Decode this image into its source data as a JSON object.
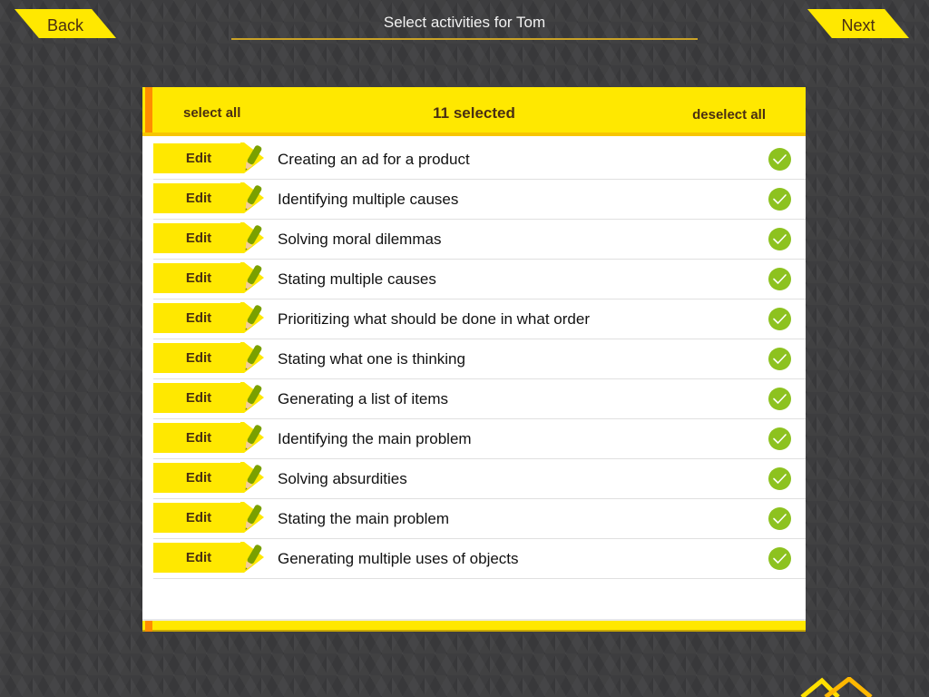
{
  "nav": {
    "back_label": "Back",
    "next_label": "Next",
    "title": "Select activities for Tom"
  },
  "panel": {
    "select_all_label": "select all",
    "deselect_all_label": "deselect all",
    "selected_count": "11 selected",
    "edit_label": "Edit",
    "items": [
      {
        "label": "Creating an ad for a product",
        "selected": true
      },
      {
        "label": "Identifying multiple causes",
        "selected": true
      },
      {
        "label": "Solving moral dilemmas",
        "selected": true
      },
      {
        "label": "Stating multiple causes",
        "selected": true
      },
      {
        "label": "Prioritizing what should be done in what order",
        "selected": true
      },
      {
        "label": "Stating what one is thinking",
        "selected": true
      },
      {
        "label": "Generating a list of items",
        "selected": true
      },
      {
        "label": "Identifying the main problem",
        "selected": true
      },
      {
        "label": "Solving absurdities",
        "selected": true
      },
      {
        "label": "Stating the main problem",
        "selected": true
      },
      {
        "label": "Generating multiple uses of objects",
        "selected": true
      }
    ]
  },
  "colors": {
    "accent_yellow": "#ffe800",
    "accent_orange": "#ff8c00",
    "check_green": "#8dc21f",
    "text_brown": "#4a2f12"
  },
  "icons": {
    "edit_icon": "pencil-icon",
    "selected_icon": "checkmark-circle-icon",
    "logo": "home-logo-icon"
  }
}
